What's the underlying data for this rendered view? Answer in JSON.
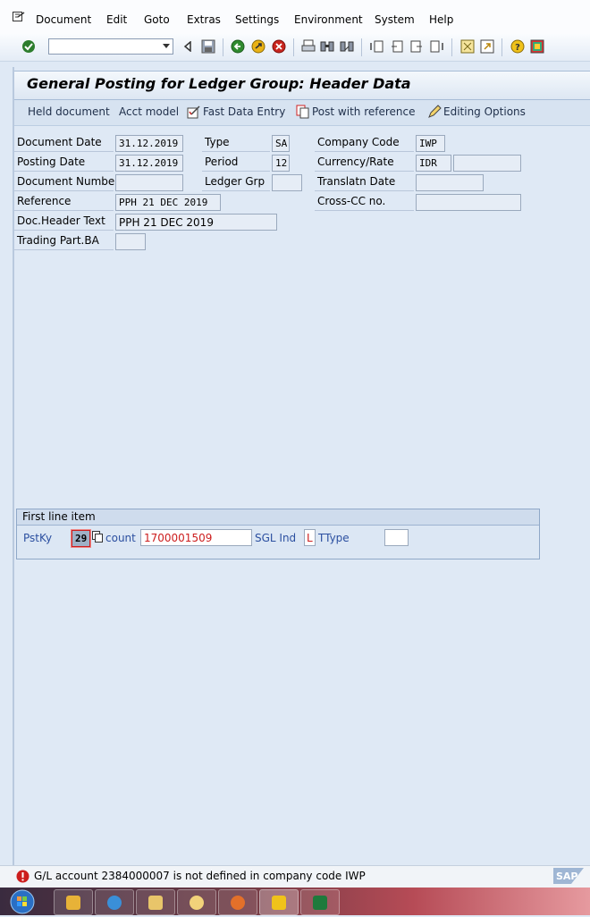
{
  "menu": {
    "items": [
      {
        "label": "Document",
        "icon": "system-menu-icon"
      },
      {
        "label": "Edit"
      },
      {
        "label": "Goto"
      },
      {
        "label": "Extras"
      },
      {
        "label": "Settings"
      },
      {
        "label": "Environment"
      },
      {
        "label": "System"
      },
      {
        "label": "Help"
      }
    ]
  },
  "toolbar": {
    "command_field": {
      "value": "",
      "placeholder": ""
    }
  },
  "page": {
    "title": "General Posting for Ledger Group: Header Data"
  },
  "app_toolbar": {
    "held_document": "Held document",
    "acct_model": "Acct model",
    "fast_data_entry": "Fast Data Entry",
    "post_with_reference": "Post with reference",
    "editing_options": "Editing Options"
  },
  "header_fields": {
    "document_date": {
      "label": "Document Date",
      "value": "31.12.2019"
    },
    "posting_date": {
      "label": "Posting Date",
      "value": "31.12.2019"
    },
    "document_number": {
      "label": "Document Number",
      "value": ""
    },
    "reference": {
      "label": "Reference",
      "value": "PPH 21 DEC 2019"
    },
    "doc_header_text": {
      "label": "Doc.Header Text",
      "value": "PPH 21 DEC 2019"
    },
    "trading_part_ba": {
      "label": "Trading Part.BA",
      "value": ""
    },
    "type": {
      "label": "Type",
      "value": "SA"
    },
    "period": {
      "label": "Period",
      "value": "12"
    },
    "ledger_grp": {
      "label": "Ledger Grp",
      "value": ""
    },
    "company_code": {
      "label": "Company Code",
      "value": "IWP"
    },
    "currency_rate": {
      "label": "Currency/Rate",
      "value": "IDR",
      "rate": ""
    },
    "translatn_date": {
      "label": "Translatn Date",
      "value": ""
    },
    "cross_cc_no": {
      "label": "Cross-CC no.",
      "value": ""
    }
  },
  "first_line_item": {
    "title": "First line item",
    "pstky_label": "PstKy",
    "pstky_value": "29",
    "account_label": "count",
    "account_value": "1700001509",
    "sgl_ind_label": "SGL Ind",
    "sgl_ind_value": "L",
    "ttype_label": "TType",
    "ttype_value": ""
  },
  "status": {
    "message": "G/L account 2384000007 is not defined in company code IWP",
    "type": "error",
    "logo": "SAP"
  },
  "taskbar": {
    "apps": [
      "windows-start-icon",
      "media-player-icon",
      "internet-explorer-icon",
      "file-explorer-icon",
      "mail-icon",
      "firefox-icon",
      "sap-logon-icon",
      "excel-icon"
    ]
  },
  "colors": {
    "background": "#dfe9f5",
    "error_red": "#cc1d1d",
    "label_blue": "#2b4fa0"
  }
}
